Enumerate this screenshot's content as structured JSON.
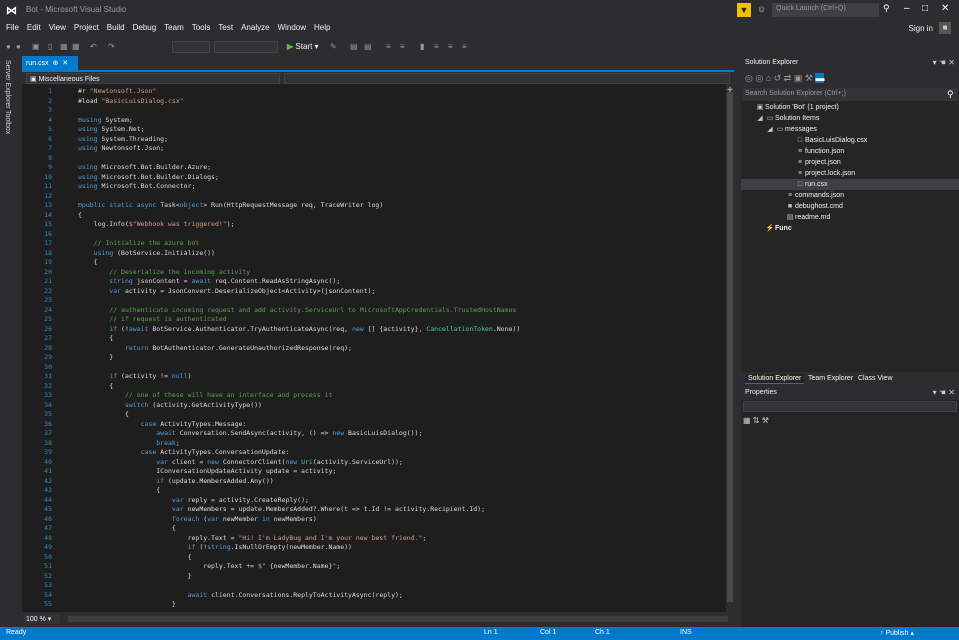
{
  "window": {
    "title": "Bot - Microsoft Visual Studio",
    "quick_launch_placeholder": "Quick Launch (Ctrl+Q)"
  },
  "menu": [
    "File",
    "Edit",
    "View",
    "Project",
    "Build",
    "Debug",
    "Team",
    "Tools",
    "Test",
    "Analyze",
    "Window",
    "Help"
  ],
  "account": {
    "sign_in": "Sign in"
  },
  "toolbar": {
    "start_label": "Start"
  },
  "left_tabs": [
    "Server Explorer",
    "Toolbox"
  ],
  "editor": {
    "tab_label": "run.csx",
    "nav_scope": "Miscellaneous Files",
    "zoom": "100 %",
    "line_numbers": [
      "1",
      "2",
      "3",
      "4",
      "5",
      "6",
      "7",
      "8",
      "9",
      "10",
      "11",
      "12",
      "13",
      "14",
      "15",
      "16",
      "17",
      "18",
      "19",
      "20",
      "21",
      "22",
      "23",
      "24",
      "25",
      "26",
      "27",
      "28",
      "29",
      "30",
      "31",
      "32",
      "33",
      "34",
      "35",
      "36",
      "37",
      "38",
      "39",
      "40",
      "41",
      "42",
      "43",
      "44",
      "45",
      "46",
      "47",
      "48",
      "49",
      "50",
      "51",
      "52",
      "53",
      "54",
      "55"
    ],
    "lines": [
      [
        [
          "#r ",
          "#dcdcdc"
        ],
        [
          "\"Newtonsoft.Json\"",
          "#d69d85"
        ]
      ],
      [
        [
          "#load ",
          "#dcdcdc"
        ],
        [
          "\"BasicLuisDialog.csx\"",
          "#d69d85"
        ]
      ],
      [],
      [
        [
          "⊟using ",
          "#569cd6"
        ],
        [
          "System;",
          "#dcdcdc"
        ]
      ],
      [
        [
          "using ",
          "#569cd6"
        ],
        [
          "System.Net;",
          "#dcdcdc"
        ]
      ],
      [
        [
          "using ",
          "#569cd6"
        ],
        [
          "System.Threading;",
          "#dcdcdc"
        ]
      ],
      [
        [
          "using ",
          "#569cd6"
        ],
        [
          "Newtonsoft.Json;",
          "#dcdcdc"
        ]
      ],
      [],
      [
        [
          "using ",
          "#569cd6"
        ],
        [
          "Microsoft.Bot.Builder.Azure;",
          "#dcdcdc"
        ]
      ],
      [
        [
          "using ",
          "#569cd6"
        ],
        [
          "Microsoft.Bot.Builder.Dialogs;",
          "#dcdcdc"
        ]
      ],
      [
        [
          "using ",
          "#569cd6"
        ],
        [
          "Microsoft.Bot.Connector;",
          "#dcdcdc"
        ]
      ],
      [],
      [
        [
          "⊟public static async ",
          "#569cd6"
        ],
        [
          "Task<",
          "#dcdcdc"
        ],
        [
          "object",
          "#569cd6"
        ],
        [
          "> Run(HttpRequestMessage req, TraceWriter log)",
          "#dcdcdc"
        ]
      ],
      [
        [
          "{",
          "#dcdcdc"
        ]
      ],
      [
        [
          "    log.Info(",
          "#dcdcdc"
        ],
        [
          "$\"Webhook was triggered!\"",
          "#d69d85"
        ],
        [
          ");",
          "#dcdcdc"
        ]
      ],
      [],
      [
        [
          "    // Initialize the azure bot",
          "#57a64a"
        ]
      ],
      [
        [
          "    using ",
          "#569cd6"
        ],
        [
          "(BotService.Initialize())",
          "#dcdcdc"
        ]
      ],
      [
        [
          "    {",
          "#dcdcdc"
        ]
      ],
      [
        [
          "        // Deserialize the incoming activity",
          "#57a64a"
        ]
      ],
      [
        [
          "        string ",
          "#569cd6"
        ],
        [
          "jsonContent = ",
          "#dcdcdc"
        ],
        [
          "await ",
          "#569cd6"
        ],
        [
          "req.Content.ReadAsStringAsync();",
          "#dcdcdc"
        ]
      ],
      [
        [
          "        var ",
          "#569cd6"
        ],
        [
          "activity = JsonConvert.DeserializeObject<Activity>(jsonContent);",
          "#dcdcdc"
        ]
      ],
      [],
      [
        [
          "        // authenticate incoming request and add activity.ServiceUrl to MicrosoftAppCredentials.TrustedHostNames",
          "#57a64a"
        ]
      ],
      [
        [
          "        // if request is authenticated",
          "#57a64a"
        ]
      ],
      [
        [
          "        if ",
          "#569cd6"
        ],
        [
          "(!",
          "#dcdcdc"
        ],
        [
          "await ",
          "#569cd6"
        ],
        [
          "BotService.Authenticator.TryAuthenticateAsync(req, ",
          "#dcdcdc"
        ],
        [
          "new ",
          "#569cd6"
        ],
        [
          "[] {activity}, ",
          "#dcdcdc"
        ],
        [
          "CancellationToken",
          "#4ec9b0"
        ],
        [
          ".None))",
          "#dcdcdc"
        ]
      ],
      [
        [
          "        {",
          "#dcdcdc"
        ]
      ],
      [
        [
          "            return ",
          "#569cd6"
        ],
        [
          "BotAuthenticator.GenerateUnauthorizedResponse(req);",
          "#dcdcdc"
        ]
      ],
      [
        [
          "        }",
          "#dcdcdc"
        ]
      ],
      [],
      [
        [
          "        if ",
          "#569cd6"
        ],
        [
          "(activity != ",
          "#dcdcdc"
        ],
        [
          "null",
          "#569cd6"
        ],
        [
          ")",
          "#dcdcdc"
        ]
      ],
      [
        [
          "        {",
          "#dcdcdc"
        ]
      ],
      [
        [
          "            // one of these will have an interface and process it",
          "#57a64a"
        ]
      ],
      [
        [
          "            switch ",
          "#569cd6"
        ],
        [
          "(activity.GetActivityType())",
          "#dcdcdc"
        ]
      ],
      [
        [
          "            {",
          "#dcdcdc"
        ]
      ],
      [
        [
          "                case ",
          "#569cd6"
        ],
        [
          "ActivityTypes.Message:",
          "#dcdcdc"
        ]
      ],
      [
        [
          "                    await ",
          "#569cd6"
        ],
        [
          "Conversation.SendAsync(activity, () => ",
          "#dcdcdc"
        ],
        [
          "new ",
          "#569cd6"
        ],
        [
          "BasicLuisDialog());",
          "#dcdcdc"
        ]
      ],
      [
        [
          "                    break",
          "#569cd6"
        ],
        [
          ";",
          "#dcdcdc"
        ]
      ],
      [
        [
          "                case ",
          "#569cd6"
        ],
        [
          "ActivityTypes.ConversationUpdate:",
          "#dcdcdc"
        ]
      ],
      [
        [
          "                    var ",
          "#569cd6"
        ],
        [
          "client = ",
          "#dcdcdc"
        ],
        [
          "new ",
          "#569cd6"
        ],
        [
          "ConnectorClient(",
          "#dcdcdc"
        ],
        [
          "new ",
          "#569cd6"
        ],
        [
          "Uri",
          "#4ec9b0"
        ],
        [
          "(activity.ServiceUrl));",
          "#dcdcdc"
        ]
      ],
      [
        [
          "                    IConversationUpdateActivity update = activity;",
          "#dcdcdc"
        ]
      ],
      [
        [
          "                    if ",
          "#569cd6"
        ],
        [
          "(update.MembersAdded.Any())",
          "#dcdcdc"
        ]
      ],
      [
        [
          "                    {",
          "#dcdcdc"
        ]
      ],
      [
        [
          "                        var ",
          "#569cd6"
        ],
        [
          "reply = activity.CreateReply();",
          "#dcdcdc"
        ]
      ],
      [
        [
          "                        var ",
          "#569cd6"
        ],
        [
          "newMembers = update.MembersAdded?.Where(t => t.Id != activity.Recipient.Id);",
          "#dcdcdc"
        ]
      ],
      [
        [
          "                        foreach ",
          "#569cd6"
        ],
        [
          "(",
          "#dcdcdc"
        ],
        [
          "var ",
          "#569cd6"
        ],
        [
          "newMember ",
          "#dcdcdc"
        ],
        [
          "in ",
          "#569cd6"
        ],
        [
          "newMembers)",
          "#dcdcdc"
        ]
      ],
      [
        [
          "                        {",
          "#dcdcdc"
        ]
      ],
      [
        [
          "                            reply.Text = ",
          "#dcdcdc"
        ],
        [
          "\"Hi! I'm LadyBug and I'm your new best friend.\"",
          "#d69d85"
        ],
        [
          ";",
          "#dcdcdc"
        ]
      ],
      [
        [
          "                            if ",
          "#569cd6"
        ],
        [
          "(!",
          "#dcdcdc"
        ],
        [
          "string",
          "#569cd6"
        ],
        [
          ".IsNullOrEmpty(newMember.Name))",
          "#dcdcdc"
        ]
      ],
      [
        [
          "                            {",
          "#dcdcdc"
        ]
      ],
      [
        [
          "                                reply.Text += ",
          "#dcdcdc"
        ],
        [
          "$\" ",
          "#d69d85"
        ],
        [
          "{newMember.Name}",
          "#dcdcdc"
        ],
        [
          "\"",
          "#d69d85"
        ],
        [
          ";",
          "#dcdcdc"
        ]
      ],
      [
        [
          "                            }",
          "#dcdcdc"
        ]
      ],
      [],
      [
        [
          "                            await ",
          "#569cd6"
        ],
        [
          "client.Conversations.ReplyToActivityAsync(reply);",
          "#dcdcdc"
        ]
      ],
      [
        [
          "                        }",
          "#dcdcdc"
        ]
      ]
    ]
  },
  "solution_explorer": {
    "title": "Solution Explorer",
    "search_placeholder": "Search Solution Explorer (Ctrl+;)",
    "items": [
      {
        "label": "Solution 'Bot' (1 project)",
        "icon": "solution-icon",
        "glyph": "▣",
        "indent": 0,
        "expander": ""
      },
      {
        "label": "Solution Items",
        "icon": "folder-icon",
        "glyph": "▭",
        "indent": 1,
        "expander": "◢"
      },
      {
        "label": "messages",
        "icon": "folder-icon",
        "glyph": "▭",
        "indent": 2,
        "expander": "◢"
      },
      {
        "label": "BasicLuisDialog.csx",
        "icon": "file-icon",
        "glyph": "□",
        "indent": 4,
        "expander": ""
      },
      {
        "label": "function.json",
        "icon": "json-file-icon",
        "glyph": "≡",
        "indent": 4,
        "expander": ""
      },
      {
        "label": "project.json",
        "icon": "json-file-icon",
        "glyph": "≡",
        "indent": 4,
        "expander": ""
      },
      {
        "label": "project.lock.json",
        "icon": "json-file-icon",
        "glyph": "≡",
        "indent": 4,
        "expander": ""
      },
      {
        "label": "run.csx",
        "icon": "file-icon",
        "glyph": "□",
        "indent": 4,
        "expander": "",
        "selected": true
      },
      {
        "label": "commands.json",
        "icon": "json-file-icon",
        "glyph": "≡",
        "indent": 3,
        "expander": ""
      },
      {
        "label": "debughost.cmd",
        "icon": "cmd-file-icon",
        "glyph": "■",
        "indent": 3,
        "expander": ""
      },
      {
        "label": "readme.md",
        "icon": "markdown-file-icon",
        "glyph": "▤",
        "indent": 3,
        "expander": ""
      },
      {
        "label": "Func",
        "icon": "lightning-icon",
        "glyph": "⚡",
        "indent": 1,
        "expander": ""
      }
    ],
    "tabs": [
      "Solution Explorer",
      "Team Explorer",
      "Class View"
    ]
  },
  "properties": {
    "title": "Properties"
  },
  "status": {
    "ready": "Ready",
    "line": "Ln 1",
    "col": "Col 1",
    "ch": "Ch 1",
    "mode": "INS",
    "publish": "↑ Publish ▴"
  }
}
